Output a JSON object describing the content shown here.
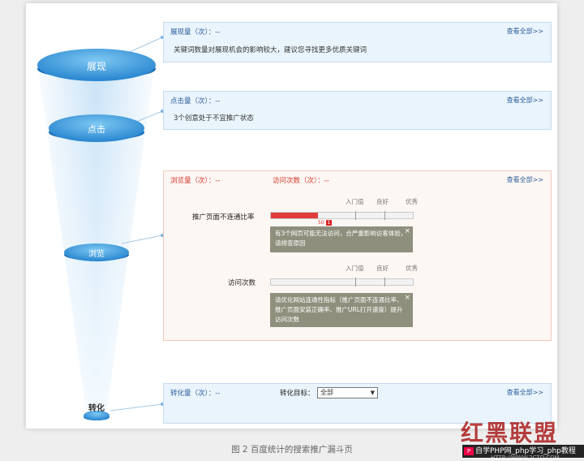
{
  "funnel": {
    "stages": [
      {
        "label": "展现"
      },
      {
        "label": "点击"
      },
      {
        "label": "浏览"
      },
      {
        "label": "转化"
      }
    ]
  },
  "panels": {
    "impressions": {
      "title": "展现量（次）：--",
      "view_all": "查看全部>>",
      "text": "关键词数量对展现机会的影响较大，建议您寻找更多优质关键词"
    },
    "clicks": {
      "title": "点击量（次）：--",
      "view_all": "查看全部>>",
      "text": "3个创意处于不宜推广状态"
    },
    "browse": {
      "title_pv": "浏览量（次）：--",
      "title_visits": "访问次数（次）：--",
      "view_all": "查看全部>>",
      "metrics": [
        {
          "label": "推广页面不连通比率",
          "thresholds": [
            "入门值",
            "良好",
            "优秀"
          ],
          "badge_value": "50",
          "badge_mark": "1",
          "fill_fraction": 0.33,
          "tip": "有3个网页可能无法访问，合严重影响访客体验，请排查原因",
          "tip_close": "×"
        },
        {
          "label": "访问次数",
          "thresholds": [
            "入门值",
            "良好",
            "优秀"
          ],
          "fill_fraction": 0,
          "tip": "请优化网站连通性指标（推广页面不连通比率、推广页面安装正确率、推广URL打开速度）提升访问次数",
          "tip_close": "×"
        }
      ]
    },
    "conversions": {
      "title": "转化量（次）：--",
      "view_all": "查看全部>>",
      "goal_label": "转化目标：",
      "goal_value": "全部"
    }
  },
  "caption": "图 2 百度统计的搜索推广漏斗页",
  "watermark": {
    "brand": "红黑联盟",
    "bar_text": "自学PHP网_php学习_php教程",
    "url": "HTTP://WWW.2CTO.COM"
  },
  "colors": {
    "funnel_blue": "#3a9de0",
    "panel_blue": "#eaf4fc",
    "panel_red": "#fdf7f4",
    "accent_red": "#e23b3b",
    "title_blue": "#2d5e9a"
  }
}
